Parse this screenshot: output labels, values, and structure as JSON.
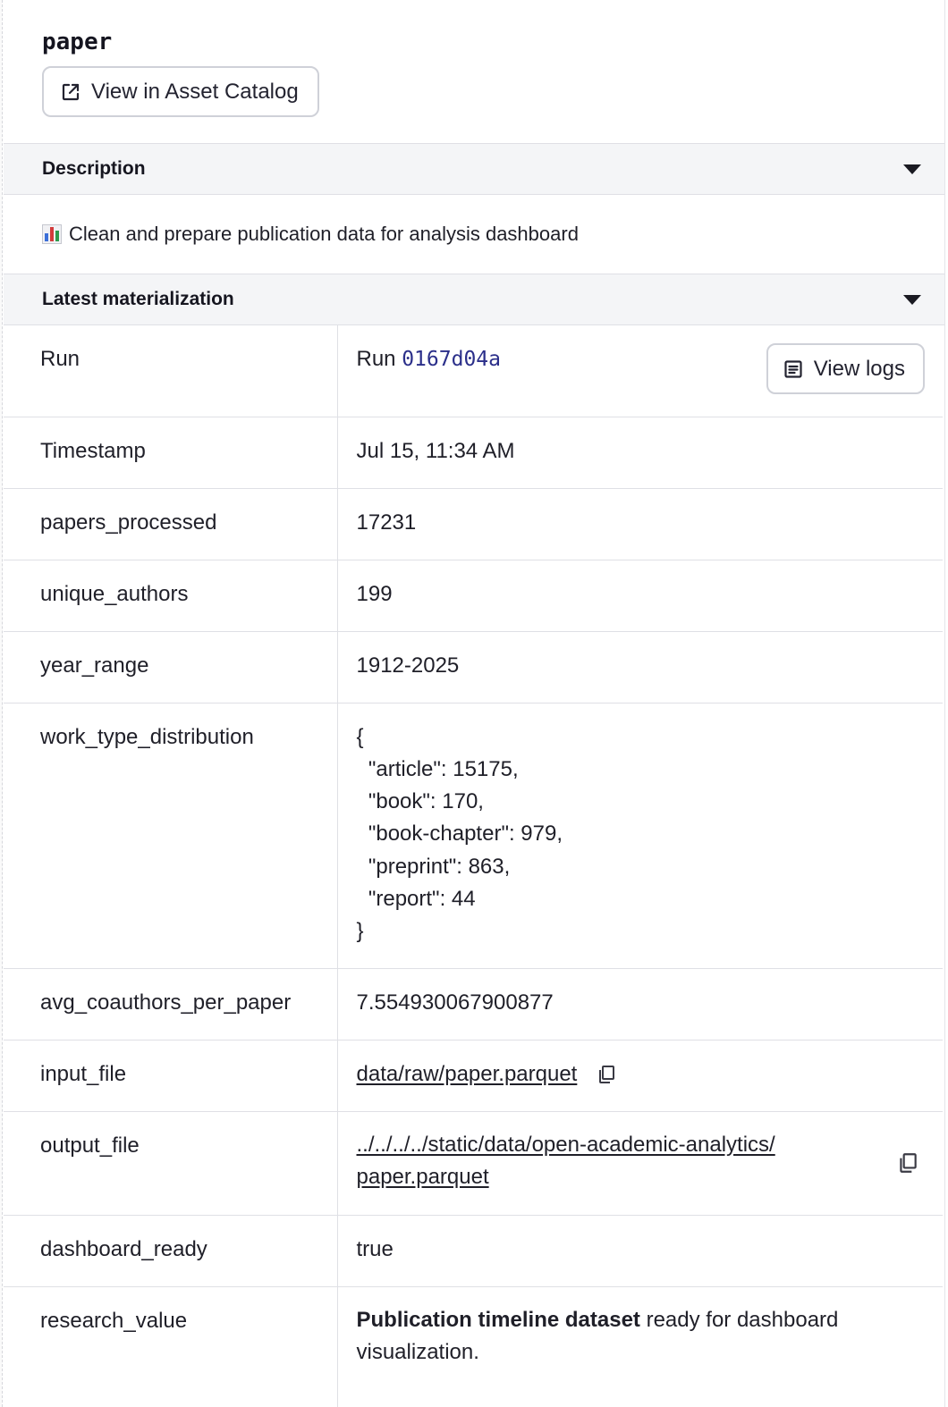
{
  "asset": {
    "title": "paper",
    "catalog_button_label": "View in Asset Catalog"
  },
  "description_section": {
    "header": "Description",
    "text": "Clean and prepare publication data for analysis dashboard"
  },
  "materialization_section": {
    "header": "Latest materialization",
    "run": {
      "key": "Run",
      "prefix": "Run",
      "run_id": "0167d04a",
      "logs_button_label": "View logs"
    },
    "timestamp": {
      "key": "Timestamp",
      "value": "Jul 15, 11:34 AM"
    },
    "rows": {
      "papers_processed": {
        "key": "papers_processed",
        "value": "17231"
      },
      "unique_authors": {
        "key": "unique_authors",
        "value": "199"
      },
      "year_range": {
        "key": "year_range",
        "value": "1912-2025"
      },
      "work_type_distribution": {
        "key": "work_type_distribution",
        "lines": [
          "{",
          "  \"article\": 15175,",
          "  \"book\": 170,",
          "  \"book-chapter\": 979,",
          "  \"preprint\": 863,",
          "  \"report\": 44",
          "}"
        ]
      },
      "avg_coauthors_per_paper": {
        "key": "avg_coauthors_per_paper",
        "value": "7.554930067900877"
      },
      "input_file": {
        "key": "input_file",
        "value": "data/raw/paper.parquet"
      },
      "output_file": {
        "key": "output_file",
        "line1": "../../../../static/data/open-academic-analytics/",
        "line2": "paper.parquet"
      },
      "dashboard_ready": {
        "key": "dashboard_ready",
        "value": "true"
      },
      "research_value": {
        "key": "research_value",
        "bold": "Publication timeline dataset",
        "rest": " ready for dashboard",
        "line2": "visualization."
      }
    }
  },
  "icons": {
    "external_link": "external-link-icon",
    "logs": "logs-icon",
    "copy": "copy-icon",
    "chart_emoji": "bar-chart-emoji-icon",
    "caret": "chevron-down-icon"
  },
  "colors": {
    "section_header_bg": "#f4f5f7",
    "run_id_link": "#2b2f8a",
    "border": "#dfe0e5"
  }
}
